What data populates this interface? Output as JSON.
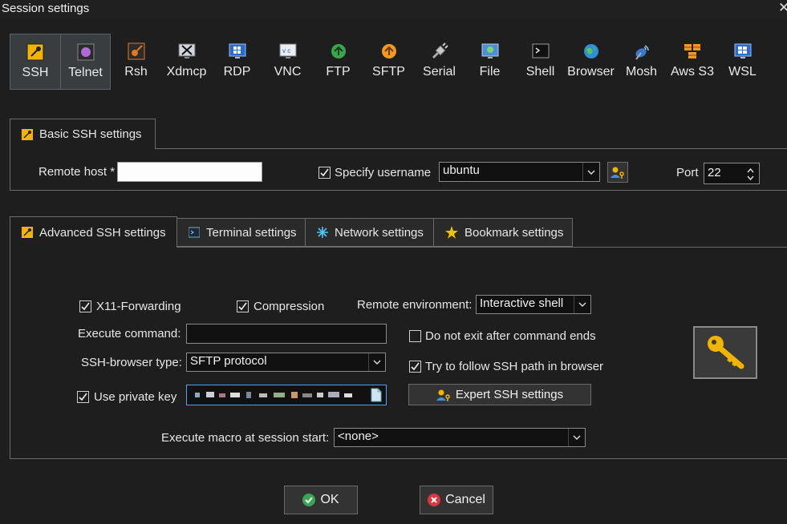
{
  "window": {
    "title": "Session settings",
    "close_glyph": "✕"
  },
  "session_types": [
    {
      "label": "SSH",
      "icon": "ssh-key-icon",
      "active": true
    },
    {
      "label": "Telnet",
      "icon": "telnet-icon",
      "active": true
    },
    {
      "label": "Rsh",
      "icon": "rsh-icon"
    },
    {
      "label": "Xdmcp",
      "icon": "xdmcp-icon"
    },
    {
      "label": "RDP",
      "icon": "rdp-icon"
    },
    {
      "label": "VNC",
      "icon": "vnc-icon"
    },
    {
      "label": "FTP",
      "icon": "ftp-icon"
    },
    {
      "label": "SFTP",
      "icon": "sftp-icon"
    },
    {
      "label": "Serial",
      "icon": "serial-icon"
    },
    {
      "label": "File",
      "icon": "file-icon"
    },
    {
      "label": "Shell",
      "icon": "shell-icon"
    },
    {
      "label": "Browser",
      "icon": "browser-icon"
    },
    {
      "label": "Mosh",
      "icon": "mosh-icon"
    },
    {
      "label": "Aws S3",
      "icon": "aws-s3-icon"
    },
    {
      "label": "WSL",
      "icon": "wsl-icon"
    }
  ],
  "basic": {
    "tab_label": "Basic SSH settings",
    "remote_host_label": "Remote host *",
    "remote_host_value": "",
    "specify_username_label": "Specify username",
    "specify_username_checked": true,
    "username_value": "ubuntu",
    "port_label": "Port",
    "port_value": "22"
  },
  "tabs": [
    {
      "label": "Advanced SSH settings",
      "active": true
    },
    {
      "label": "Terminal settings"
    },
    {
      "label": "Network settings"
    },
    {
      "label": "Bookmark settings"
    }
  ],
  "advanced": {
    "x11_label": "X11-Forwarding",
    "x11_checked": true,
    "compression_label": "Compression",
    "compression_checked": true,
    "remote_env_label": "Remote environment:",
    "remote_env_value": "Interactive shell",
    "execute_command_label": "Execute command:",
    "execute_command_value": "",
    "do_not_exit_label": "Do not exit after command ends",
    "do_not_exit_checked": false,
    "browser_type_label": "SSH-browser type:",
    "browser_type_value": "SFTP protocol",
    "follow_path_label": "Try to follow SSH path in browser",
    "follow_path_checked": true,
    "private_key_label": "Use private key",
    "private_key_checked": true,
    "expert_button_label": "Expert SSH settings",
    "macro_label": "Execute macro at session start:",
    "macro_value": "<none>"
  },
  "footer": {
    "ok_label": "OK",
    "cancel_label": "Cancel"
  },
  "colors": {
    "background": "#1e1e1e",
    "ok_green": "#3aa655",
    "cancel_red": "#d9363e",
    "accent_blue": "#4aa3ff"
  }
}
